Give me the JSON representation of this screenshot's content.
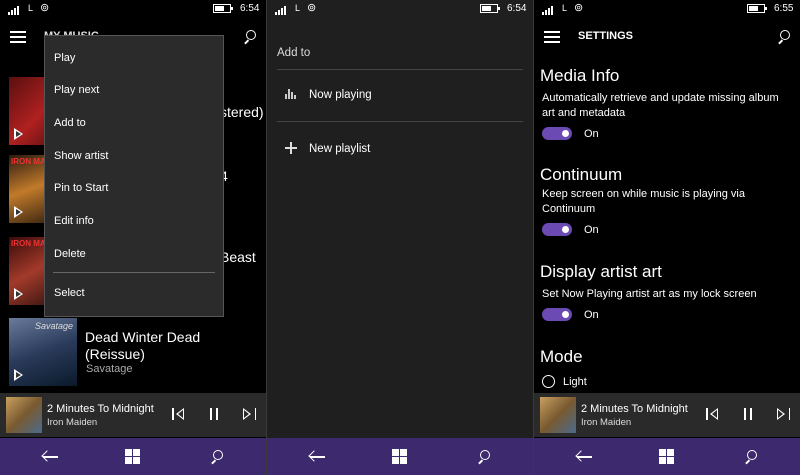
{
  "status": [
    {
      "net": "L",
      "time": "6:54"
    },
    {
      "net": "L",
      "time": "6:54"
    },
    {
      "net": "L",
      "time": "6:55"
    }
  ],
  "music": {
    "header_title": "MY MUSIC",
    "albums_partial": [
      "stered)",
      "4",
      "Beast"
    ],
    "album_title": "Dead Winter Dead (Reissue)",
    "album_artist": "Savatage"
  },
  "context_menu": [
    "Play",
    "Play next",
    "Add to",
    "Show artist",
    "Pin to Start",
    "Edit info",
    "Delete",
    "Select"
  ],
  "add_to": {
    "title": "Add to",
    "now_playing": "Now playing",
    "new_playlist": "New playlist"
  },
  "now_playing": {
    "track": "2 Minutes To Midnight",
    "artist": "Iron Maiden"
  },
  "settings": {
    "title": "SETTINGS",
    "media_info": {
      "title": "Media Info",
      "desc": "Automatically retrieve and update missing album art and metadata",
      "state": "On"
    },
    "continuum": {
      "title": "Continuum",
      "desc": "Keep screen on while music is playing via Continuum",
      "state": "On"
    },
    "artist_art": {
      "title": "Display artist art",
      "desc": "Set Now Playing artist art as my lock screen",
      "state": "On"
    },
    "mode": {
      "title": "Mode",
      "option": "Light"
    }
  },
  "colors": {
    "accent": "#6b4bb3",
    "navbar": "#3d2a6e",
    "menu_bg": "#2b2b2b"
  },
  "icons": [
    "hamburger-icon",
    "search-icon",
    "play-icon",
    "equalizer-icon",
    "plus-icon",
    "previous-icon",
    "pause-icon",
    "next-icon",
    "back-icon",
    "windows-icon"
  ]
}
